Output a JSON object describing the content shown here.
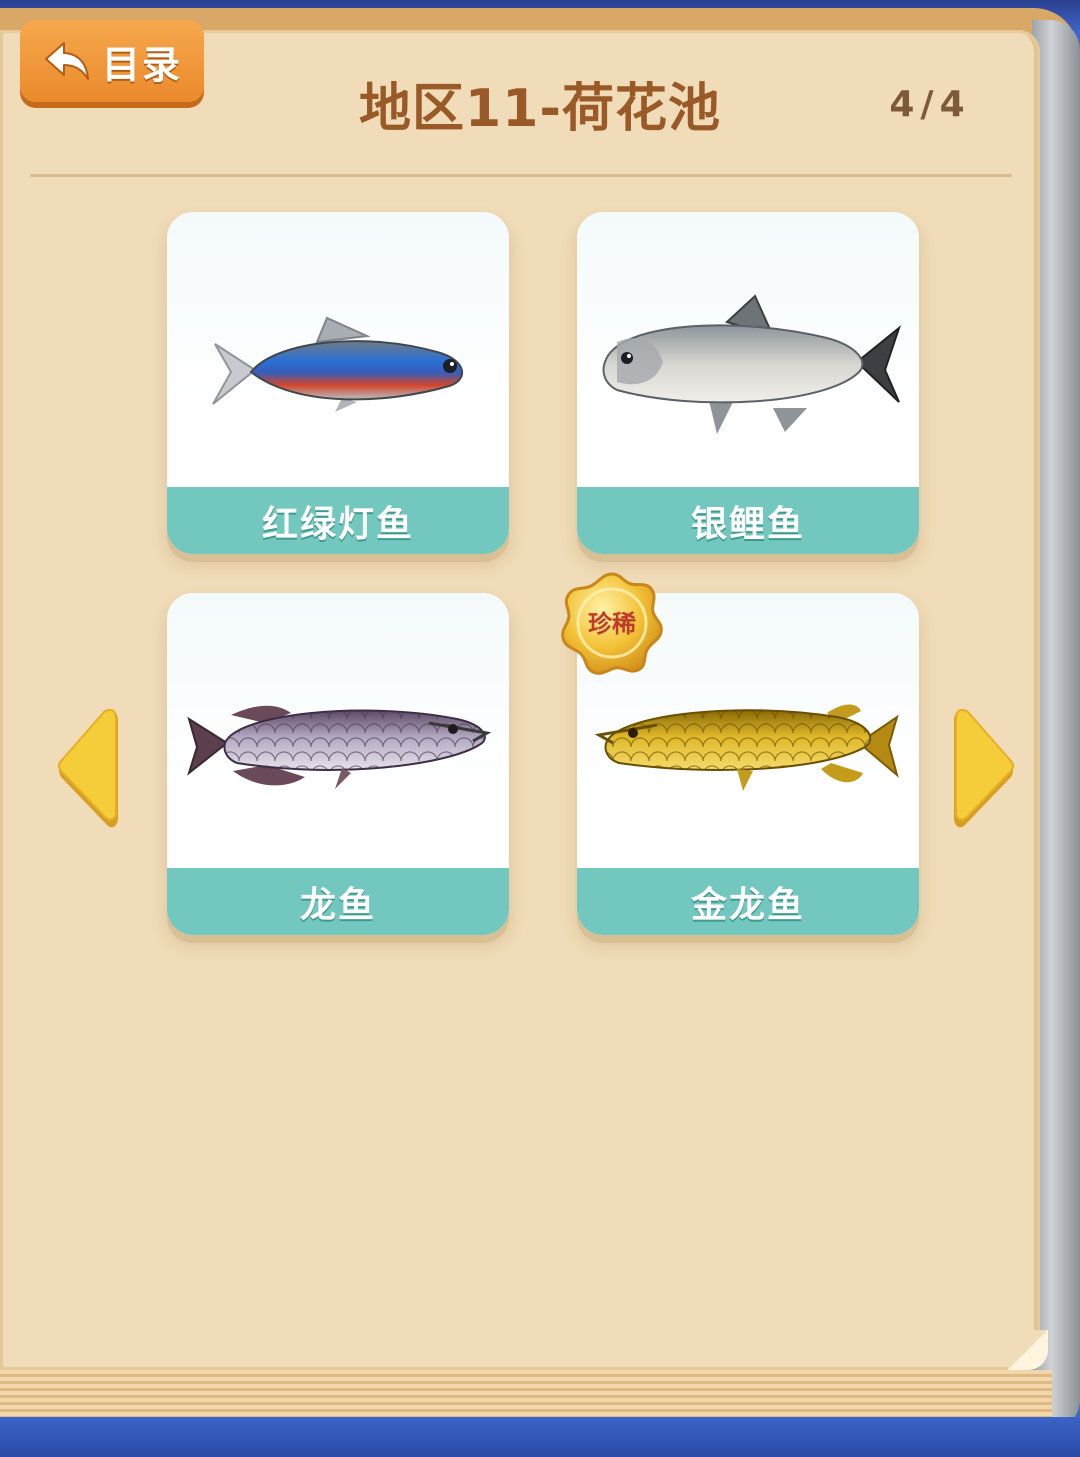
{
  "header": {
    "back_label": "目录",
    "back_icon": "return-arrow-icon",
    "title": "地区11-荷花池",
    "page_indicator": "4/4"
  },
  "fish_cards": [
    {
      "name": "红绿灯鱼",
      "icon": "neon-tetra-fish-image",
      "rare": false
    },
    {
      "name": "银鲤鱼",
      "icon": "silver-carp-fish-image",
      "rare": false
    },
    {
      "name": "龙鱼",
      "icon": "arowana-fish-image",
      "rare": false
    },
    {
      "name": "金龙鱼",
      "icon": "golden-arowana-fish-image",
      "rare": true,
      "rare_label": "珍稀"
    }
  ],
  "navigation": {
    "prev_icon": "arrow-left-icon",
    "next_icon": "arrow-right-icon"
  },
  "colors": {
    "page_bg": "#f0dcb8",
    "title": "#9a5a28",
    "card_label_bar": "#72c7be",
    "back_button": "#ea8a2c",
    "arrow": "#f5cd3a",
    "rare_badge": "#f0b72a"
  }
}
